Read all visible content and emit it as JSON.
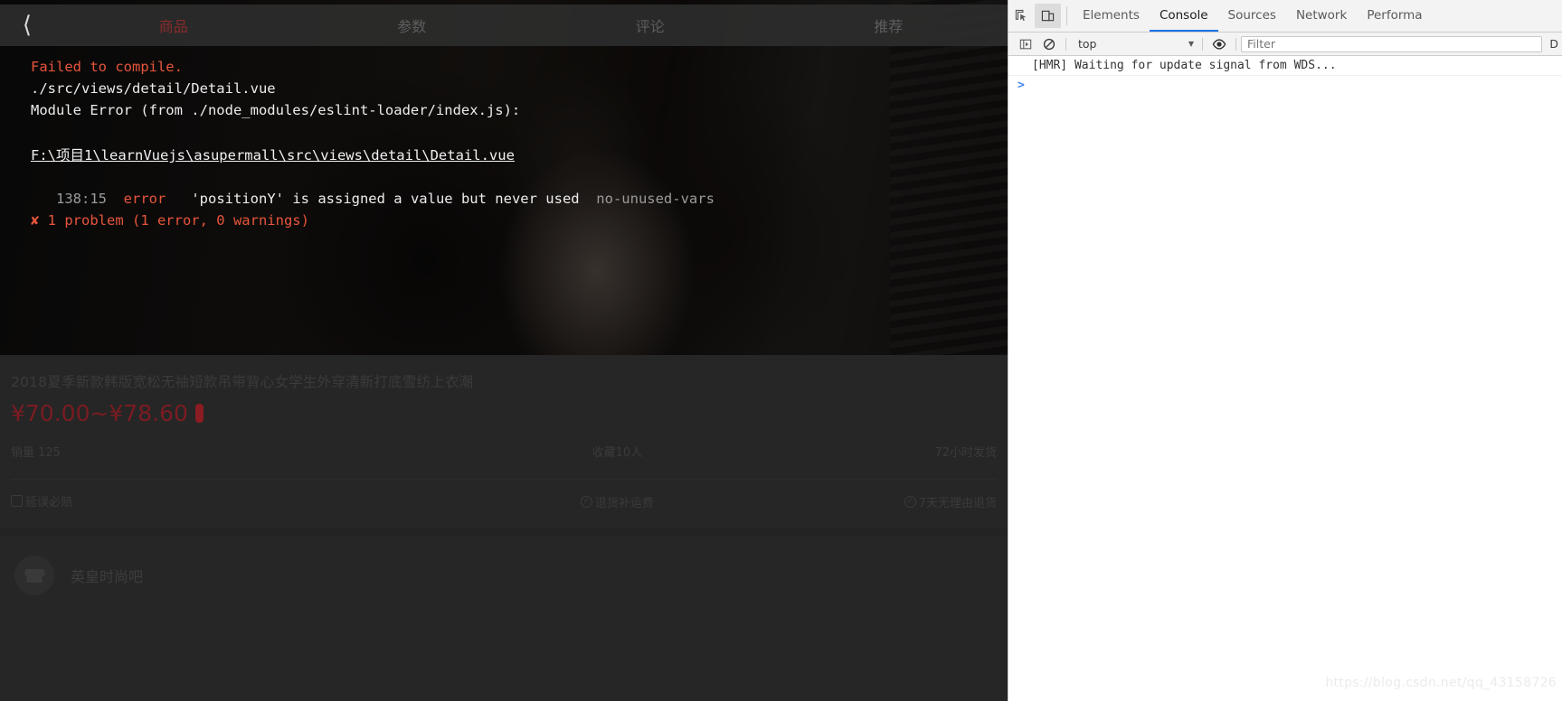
{
  "app": {
    "navbar": {
      "back_icon": "chevron-left-icon",
      "tabs": [
        {
          "label": "商品",
          "active": true
        },
        {
          "label": "参数",
          "active": false
        },
        {
          "label": "评论",
          "active": false
        },
        {
          "label": "推荐",
          "active": false
        }
      ]
    },
    "product": {
      "title": "2018夏季新款韩版宽松无袖短款吊带背心女学生外穿清新打底雪纺上衣潮",
      "price": "¥70.00~¥78.60",
      "price_color": "#7a1c22",
      "sales_label": "销量 125",
      "collect_label": "收藏10人",
      "shipping_label": "72小时发货"
    },
    "services": [
      {
        "icon": "square-unchecked-icon",
        "glyph": "",
        "label": "延误必赔"
      },
      {
        "icon": "check-circle-icon",
        "glyph": "✓",
        "label": "退货补运费"
      },
      {
        "icon": "check-circle-icon",
        "glyph": "✓",
        "label": "7天无理由退货"
      }
    ],
    "shop": {
      "avatar_icon": "store-icon",
      "name": "英皇时尚吧"
    }
  },
  "error_overlay": {
    "headline": "Failed to compile.",
    "module_lines": [
      "./src/views/detail/Detail.vue",
      "Module Error (from ./node_modules/eslint-loader/index.js):"
    ],
    "file_path": "F:\\项目1\\learnVuejs\\asupermall\\src\\views\\detail\\Detail.vue",
    "detail": {
      "location": "138:15",
      "severity": "error",
      "message": "'positionY' is assigned a value but never used",
      "rule": "no-unused-vars"
    },
    "summary": "✘ 1 problem (1 error, 0 warnings)",
    "headline_color": "#e8553c"
  },
  "devtools": {
    "toolbar_icons": [
      {
        "name": "inspect-element-icon",
        "active": false
      },
      {
        "name": "device-toolbar-icon",
        "active": true
      }
    ],
    "tabs": [
      {
        "label": "Elements",
        "active": false
      },
      {
        "label": "Console",
        "active": true
      },
      {
        "label": "Sources",
        "active": false
      },
      {
        "label": "Network",
        "active": false
      },
      {
        "label": "Performa",
        "active": false
      }
    ],
    "console_toolbar": {
      "sidebar_icon": "show-console-sidebar-icon",
      "clear_icon": "clear-console-icon",
      "context": "top",
      "caret": "▼",
      "eye_icon": "live-expression-icon",
      "filter_placeholder": "Filter",
      "levels_label": "D"
    },
    "messages": [
      {
        "text": "[HMR] Waiting for update signal from WDS..."
      }
    ],
    "prompt": ">",
    "accent_color": "#1a73e8"
  },
  "watermark": "https://blog.csdn.net/qq_43158726"
}
